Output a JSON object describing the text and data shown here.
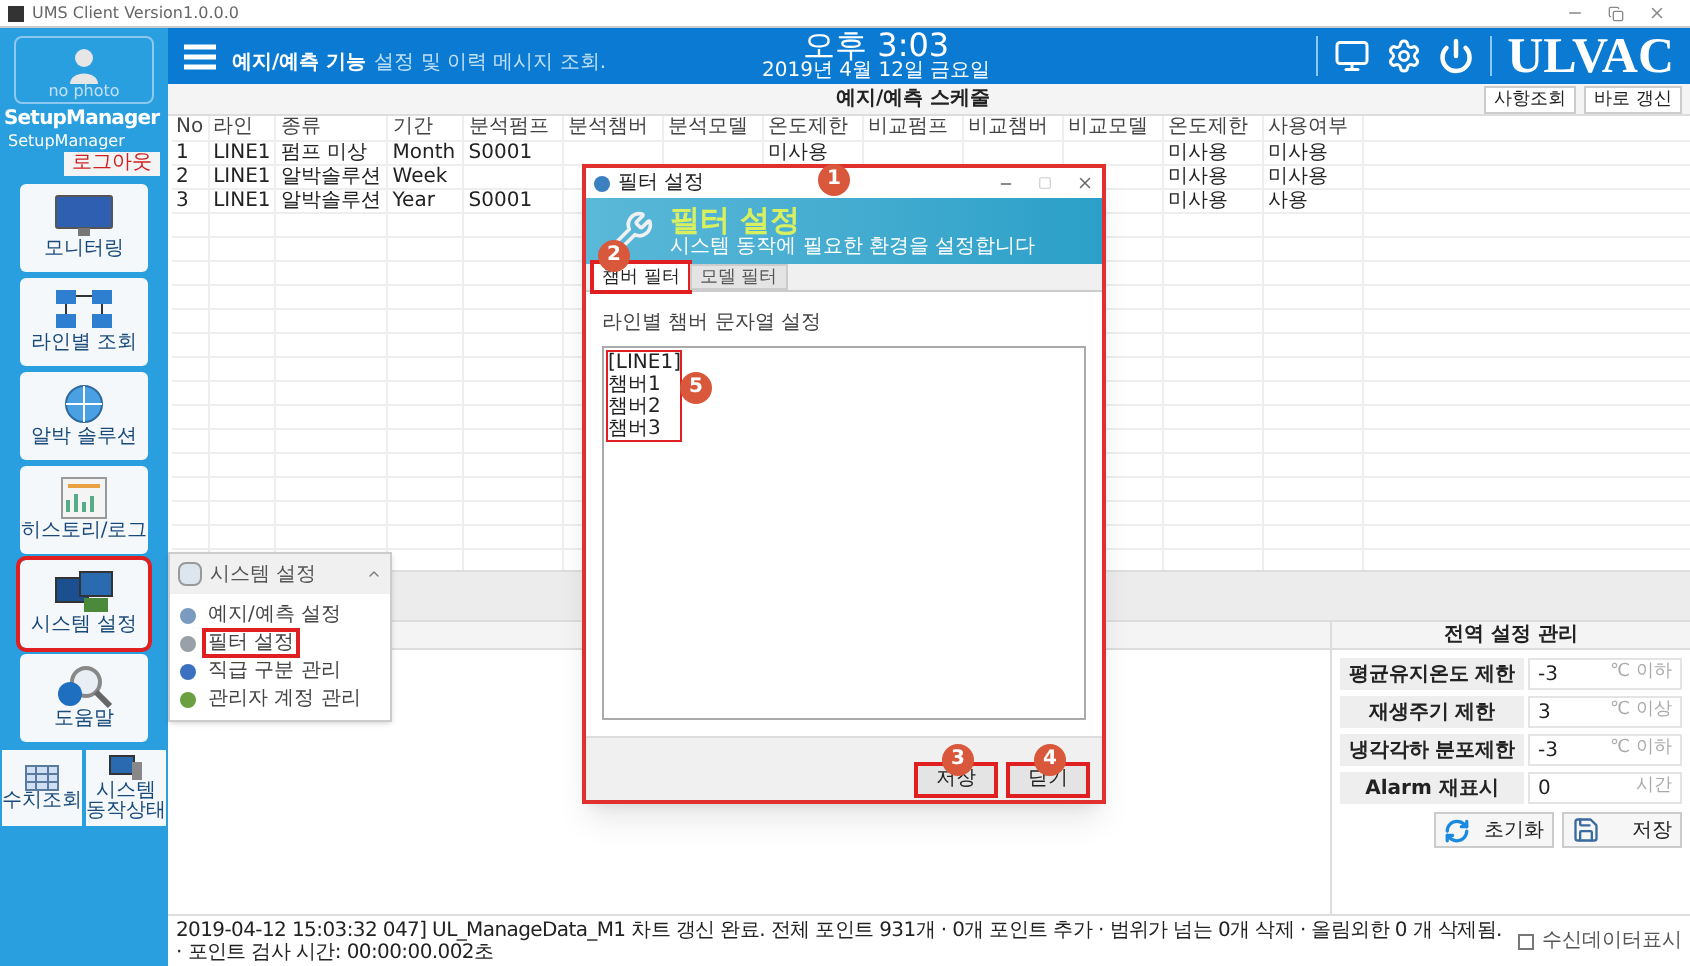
{
  "window": {
    "title": "UMS Client Version1.0.0.0"
  },
  "sidebar": {
    "photo_label": "no photo",
    "user_name": "SetupManager",
    "user_id": "SetupManager",
    "logout": "로그아웃",
    "nav": [
      {
        "kind": "monitor",
        "label": "모니터링",
        "selected": false
      },
      {
        "kind": "network",
        "label": "라인별 조회",
        "selected": false
      },
      {
        "kind": "globe",
        "label": "알박 솔루션",
        "selected": false
      },
      {
        "kind": "report",
        "label": "히스토리/로그",
        "selected": false
      },
      {
        "kind": "system",
        "label": "시스템 설정",
        "selected": true
      },
      {
        "kind": "help",
        "label": "도움말",
        "selected": false
      }
    ],
    "small_nav": [
      {
        "kind": "calendar",
        "label": "수치조회"
      },
      {
        "kind": "computer",
        "label": "시스템 동작상태"
      }
    ]
  },
  "header": {
    "title": "예지/예측 기능",
    "subtitle": "설정 및 이력 메시지 조회.",
    "time": "오후 3:03",
    "date": "2019년 4월 12일 금요일",
    "logo": "ULVAC"
  },
  "schedule": {
    "title": "예지/예측 스케줄",
    "buttons": [
      "사항조회",
      "바로 갱신"
    ],
    "table": {
      "columns": [
        "No",
        "라인",
        "종류",
        "기간",
        "분석펌프",
        "분석챔버",
        "분석모델",
        "온도제한",
        "비교펌프",
        "비교챔버",
        "비교모델",
        "온도제한",
        "사용여부"
      ],
      "rows": [
        [
          "1",
          "LINE1",
          "펌프 미상",
          "Month",
          "S0001",
          null,
          null,
          "미사용",
          null,
          null,
          null,
          "미사용",
          "미사용"
        ],
        [
          "2",
          "LINE1",
          "알박솔루션",
          "Week",
          null,
          null,
          null,
          null,
          null,
          null,
          null,
          "미사용",
          "미사용"
        ],
        [
          "3",
          "LINE1",
          "알박솔루션",
          "Year",
          "S0001",
          null,
          null,
          null,
          null,
          null,
          null,
          "미사용",
          "사용"
        ]
      ]
    }
  },
  "system_menu": {
    "title": "시스템 설정",
    "items": [
      {
        "kind": "schedule",
        "label": "예지/예측 설정",
        "highlighted": false
      },
      {
        "kind": "filter",
        "label": "필터 설정",
        "highlighted": true
      },
      {
        "kind": "rank",
        "label": "직급 구분 관리",
        "highlighted": false
      },
      {
        "kind": "admin",
        "label": "관리자 계정 관리",
        "highlighted": false
      }
    ]
  },
  "global_settings": {
    "title": "전역 설정 관리",
    "rows": [
      {
        "label": "평균유지온도 제한",
        "value": "-3",
        "unit": "℃ 이하"
      },
      {
        "label": "재생주기 제한",
        "value": "3",
        "unit": "℃ 이상"
      },
      {
        "label": "냉각각하 분포제한",
        "value": "-3",
        "unit": "℃ 이하"
      },
      {
        "label": "Alarm 재표시",
        "value": "0",
        "unit": "시간"
      }
    ],
    "buttons": [
      {
        "kind": "reset",
        "label": "초기화"
      },
      {
        "kind": "save",
        "label": "저장"
      }
    ]
  },
  "status_bar": {
    "message": "2019-04-12 15:03:32 047] UL_ManageData_M1 차트 갱신 완료. 전체 포인트 931개 · 0개 포인트 추가 · 범위가 넘는 0개 삭제 · 올림외한 0 개 삭제됨. · 포인트 검사 시간: 00:00:00.002초",
    "checkbox": {
      "label": "수신데이터표시",
      "checked": false
    }
  },
  "dialog": {
    "title": "필터 설정",
    "callout": "1",
    "highlighted": true,
    "banner_title": "필터 설정",
    "banner_subtitle": "시스템 동작에 필요한 환경을 설정합니다",
    "tabs": [
      {
        "label": "챔버 필터",
        "selected": true,
        "highlighted": true,
        "callout": "2"
      },
      {
        "label": "모델 필터",
        "selected": false,
        "highlighted": false
      }
    ],
    "section_label": "라인별 챔버 문자열 설정",
    "text_lines": [
      "[LINE1]",
      "챔버1",
      "챔버2",
      "챔버3"
    ],
    "text_highlighted": true,
    "text_callout": "5",
    "buttons": [
      {
        "label": "저장",
        "highlighted": true,
        "callout": "3"
      },
      {
        "label": "닫기",
        "highlighted": true,
        "callout": "4"
      }
    ]
  }
}
